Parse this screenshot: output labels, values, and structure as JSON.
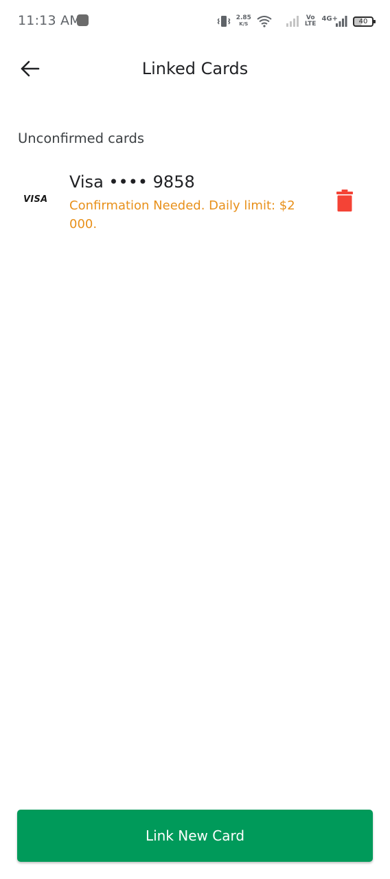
{
  "status_bar": {
    "time": "11:13 AM",
    "speed_value": "2.85",
    "speed_unit": "K/S",
    "volte_top": "Vo",
    "volte_bottom": "LTE",
    "network": "4G+",
    "battery": "40",
    "icons": [
      "vibrate-icon",
      "wifi-icon",
      "signal-empty-icon",
      "signal-icon"
    ]
  },
  "app_bar": {
    "title": "Linked Cards",
    "back_icon": "arrow-left-icon"
  },
  "sections": {
    "unconfirmed": {
      "title": "Unconfirmed cards",
      "cards": [
        {
          "brand": "VISA",
          "name": "Visa •••• 9858",
          "status": "Confirmation Needed. Daily limit: $2 000.",
          "delete_icon": "trash-icon"
        }
      ]
    }
  },
  "footer": {
    "link_new_card_label": "Link New Card"
  },
  "colors": {
    "primary_green": "#009a5a",
    "warning_orange": "#e8901a",
    "delete_red": "#f44336"
  }
}
